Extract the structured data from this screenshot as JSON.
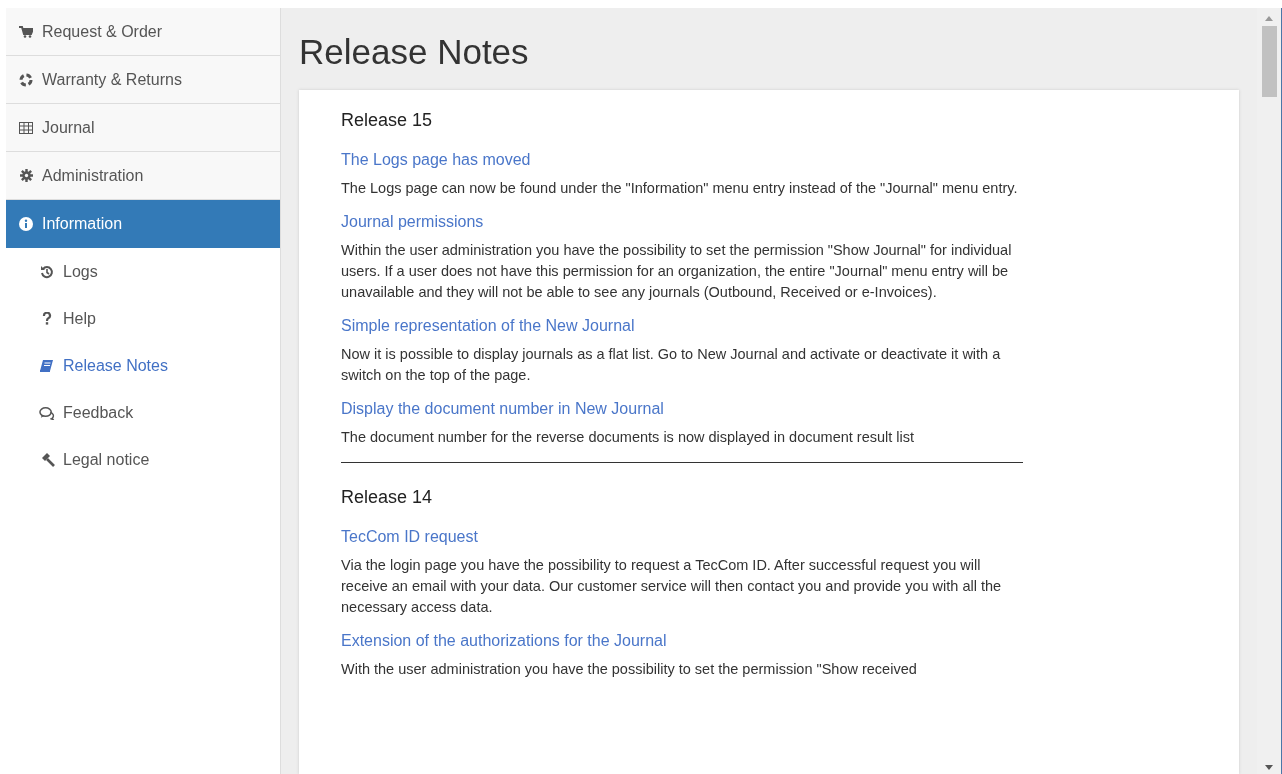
{
  "sidebar": {
    "items": [
      {
        "label": "Request & Order",
        "selected": false
      },
      {
        "label": "Warranty & Returns",
        "selected": false
      },
      {
        "label": "Journal",
        "selected": false
      },
      {
        "label": "Administration",
        "selected": false
      },
      {
        "label": "Information",
        "selected": true,
        "children": [
          {
            "label": "Logs",
            "selected": false
          },
          {
            "label": "Help",
            "selected": false
          },
          {
            "label": "Release Notes",
            "selected": true
          },
          {
            "label": "Feedback",
            "selected": false
          },
          {
            "label": "Legal notice",
            "selected": false
          }
        ]
      }
    ]
  },
  "page": {
    "title": "Release Notes",
    "releases": [
      {
        "title": "Release 15",
        "sections": [
          {
            "heading": "The Logs page has moved",
            "text": "The Logs page can now be found under the \"Information\" menu entry instead of the \"Journal\" menu entry."
          },
          {
            "heading": "Journal permissions",
            "text": "Within the user administration you have the possibility to set the permission \"Show Journal\" for individual users. If a user does not have this permission for an organization, the entire \"Journal\" menu entry will be unavailable and they will not be able to see any journals (Outbound, Received or e-Invoices)."
          },
          {
            "heading": "Simple representation of the New Journal",
            "text": "Now it is possible to display journals as a flat list. Go to New Journal and activate or deactivate it with a switch on the top of the page."
          },
          {
            "heading": "Display the document number in New Journal",
            "text": "The document number for the reverse documents is now displayed in document result list"
          }
        ]
      },
      {
        "title": "Release 14",
        "sections": [
          {
            "heading": "TecCom ID request",
            "text": "Via the login page you have the possibility to request a TecCom ID. After successful request you will receive an email with your data. Our customer service will then contact you and provide you with all the necessary access data."
          },
          {
            "heading": "Extension of the authorizations for the Journal",
            "text": "With the user administration you have the possibility to set the permission \"Show received"
          }
        ]
      }
    ]
  }
}
